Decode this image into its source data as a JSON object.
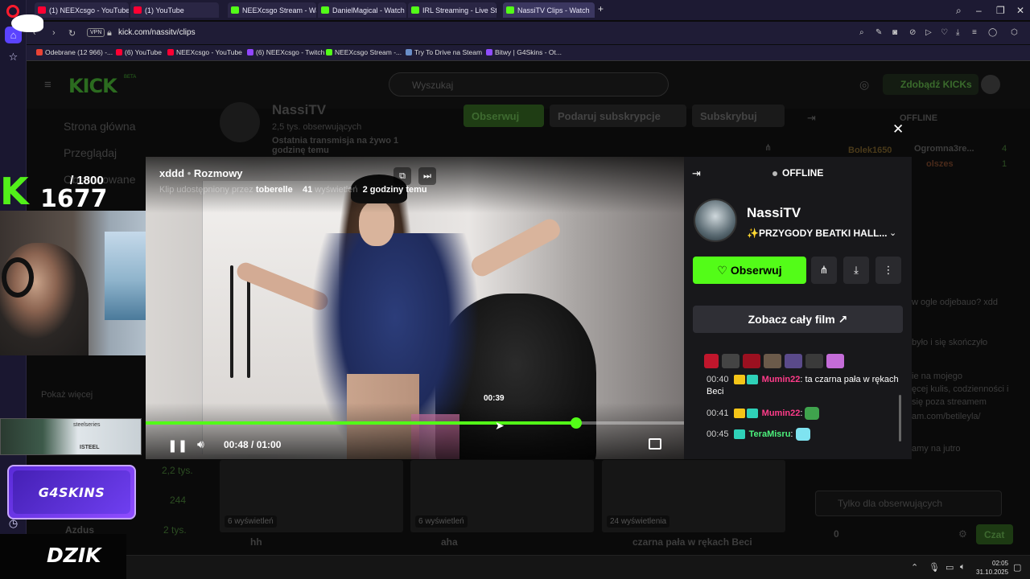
{
  "browser": {
    "tabs": [
      {
        "label": "(1) NEEXcsgo - YouTube",
        "icon": "youtube-icon",
        "color": "#ff0033"
      },
      {
        "label": "(1) YouTube",
        "icon": "youtube-icon",
        "color": "#ff0033"
      },
      {
        "label": "NEEXcsgo Stream - Watch",
        "icon": "kick-icon",
        "color": "#53fc18"
      },
      {
        "label": "DanielMagical - Watch the",
        "icon": "kick-icon",
        "color": "#53fc18"
      },
      {
        "label": "IRL Streaming - Live Strea",
        "icon": "kick-icon",
        "color": "#53fc18"
      },
      {
        "label": "NassiTV Clips - Watch",
        "icon": "kick-icon",
        "color": "#53fc18"
      }
    ],
    "new_tab": "+",
    "vpn": "VPN",
    "url": "kick.com/nassitv/clips",
    "bookmarks": [
      {
        "label": "Odebrane (12 966) -...",
        "color": "#ea4335"
      },
      {
        "label": "(6) YouTube",
        "color": "#ff0033"
      },
      {
        "label": "NEEXcsgo - YouTube",
        "color": "#ff0033"
      },
      {
        "label": "(6) NEEXcsgo - Twitch",
        "color": "#9146ff"
      },
      {
        "label": "NEEXcsgo Stream -...",
        "color": "#53fc18"
      },
      {
        "label": "Try To Drive na Steam",
        "color": "#6a8ec9"
      },
      {
        "label": "Bitwy | G4Skins - Ot...",
        "color": "#8f4dff"
      }
    ]
  },
  "kick": {
    "logo": "KICK",
    "beta": "BETA",
    "search_placeholder": "Wyszukaj",
    "get_kicks": "Zdobądź KICKs",
    "nav": [
      "Strona główna",
      "Przeglądaj",
      "Obserwowane"
    ],
    "show_more": "Pokaż więcej",
    "channel_name": "NassiTV",
    "followers": "2,5 tys. obserwujących",
    "last_stream": "Ostatnia transmisja na żywo 1 godzinę temu",
    "buttons": {
      "follow": "Obserwuj",
      "gift": "Podaruj subskrypcje",
      "subscribe": "Subskrybuj"
    },
    "sidebar_counts": [
      "2,2 tys.",
      "244",
      "2 tys."
    ],
    "sidebar_user": "Azdus",
    "thumbs": [
      {
        "views": "6 wyświetleń",
        "title": "hh"
      },
      {
        "views": "6 wyświetleń",
        "title": "aha"
      },
      {
        "views": "24 wyświetlenia",
        "title": "czarna pała w rękach Beci"
      }
    ],
    "chat_bg": {
      "offline": "OFFLINE",
      "users": [
        "Bolek1650",
        "Ogromna3re...",
        "olszes"
      ],
      "counts": [
        "4",
        "1"
      ],
      "lines": [
        "w ogle odjebauo? xdd",
        "było i się skończyło",
        "ie na mojego",
        "ęcej kulis, codzienności i",
        "się poza streamem",
        "am.com/betileyla/",
        "amy na jutro"
      ],
      "placeholder": "Tylko dla obserwujących",
      "kicks": "0",
      "send": "Czat"
    }
  },
  "stream_overlay": {
    "kick_mark": "K",
    "goal_small": "/ 1800",
    "goal_big": "1677",
    "sponsor_1": "steelseries",
    "sponsor_1_sub": "ISTEEL",
    "sponsor_2": "G4SKINS",
    "sponsor_3": "DZIK"
  },
  "clip": {
    "title": "xddd",
    "category": "Rozmowy",
    "sub_prefix": "Klip udostępniony przez",
    "clipper": "toberelle",
    "views": "41",
    "views_label": "wyświetleń",
    "age": "2 godziny temu",
    "hover_time": "00:39",
    "time": "00:48 / 01:00",
    "progress": 0.8
  },
  "panel": {
    "status": "OFFLINE",
    "name": "NassiTV",
    "stream_title": "✨PRZYGODY BEATKI HALL...",
    "follow": "Obserwuj",
    "watch_full": "Zobacz cały film",
    "chat": [
      {
        "time": "00:40",
        "user": "Mumin22",
        "user_color": "pink",
        "text": ": ta czarna pała w rękach Beci",
        "emote": false
      },
      {
        "time": "00:41",
        "user": "Mumin22",
        "user_color": "pink",
        "text": ":",
        "emote": true
      },
      {
        "time": "00:45",
        "user": "TeraMisru",
        "user_color": "green",
        "text": ":",
        "emote": true
      }
    ]
  },
  "taskbar": {
    "time": "02:05",
    "date": "31.10.2025"
  }
}
